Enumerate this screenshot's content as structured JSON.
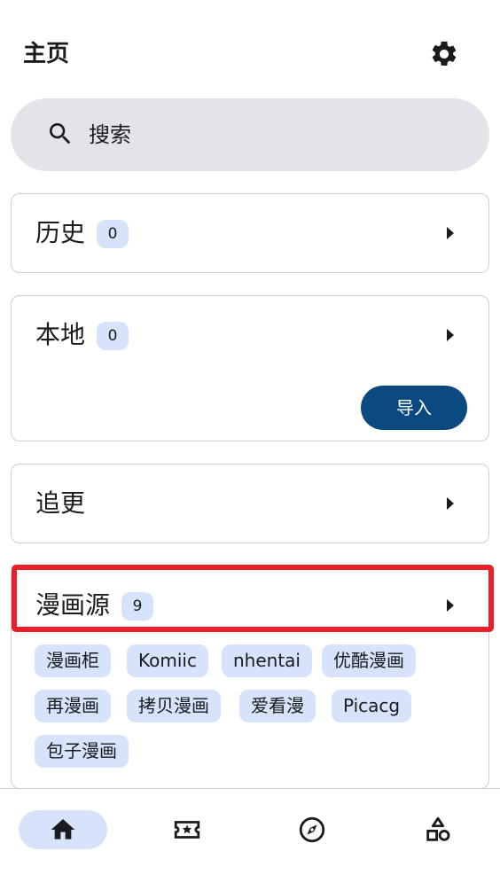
{
  "header": {
    "title": "主页",
    "settings_icon": "gear-icon"
  },
  "search": {
    "placeholder": "搜索",
    "icon": "search-icon"
  },
  "cards": {
    "history": {
      "title": "历史",
      "count": "0"
    },
    "local": {
      "title": "本地",
      "count": "0",
      "import_label": "导入"
    },
    "following": {
      "title": "追更"
    },
    "sources": {
      "title": "漫画源",
      "count": "9",
      "tags": [
        "漫画柜",
        "Komiic",
        "nhentai",
        "优酷漫画",
        "再漫画",
        "拷贝漫画",
        "爱看漫",
        "Picacg",
        "包子漫画"
      ]
    }
  },
  "bottom_nav": {
    "items": [
      {
        "icon": "home-icon",
        "active": true
      },
      {
        "icon": "favorites-icon",
        "active": false
      },
      {
        "icon": "explore-compass-icon",
        "active": false
      },
      {
        "icon": "categories-icon",
        "active": false
      }
    ]
  },
  "colors": {
    "accent": "#0b4a80",
    "badge": "#d6e3fb",
    "search_bg": "#e3e4e9",
    "highlight": "#e8202a"
  }
}
